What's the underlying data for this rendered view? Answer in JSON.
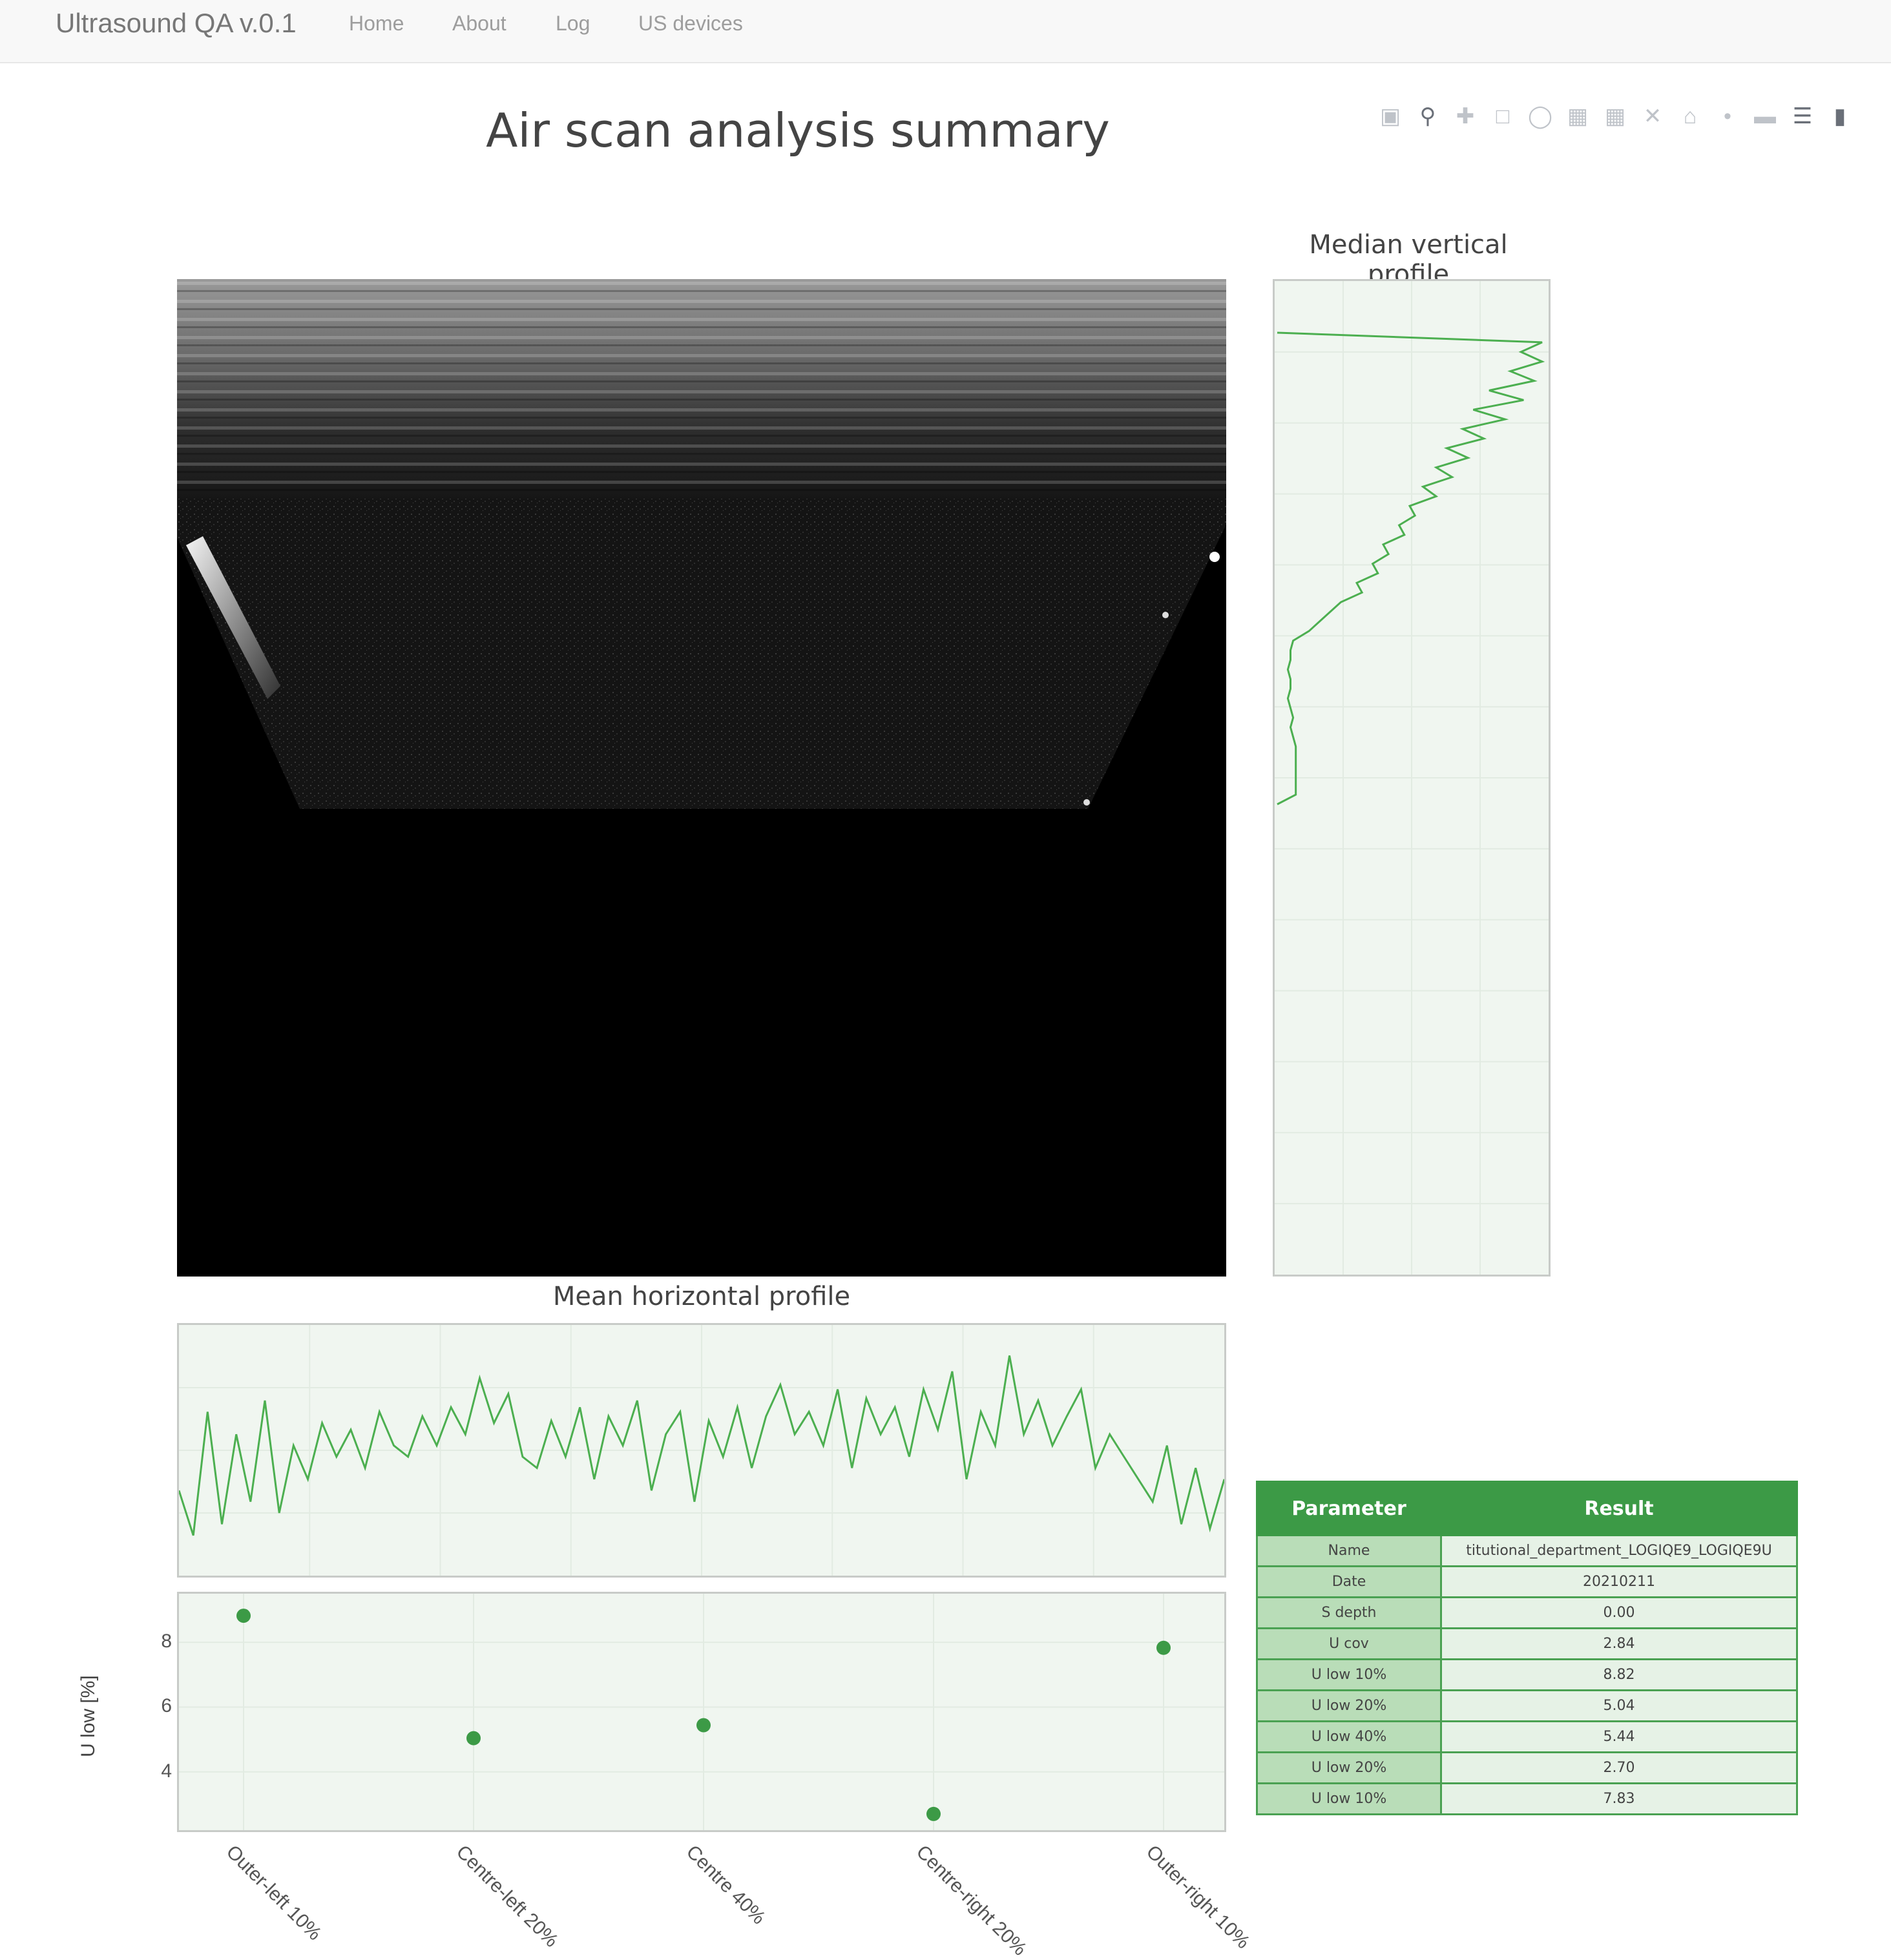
{
  "navbar": {
    "brand": "Ultrasound QA v.0.1",
    "links": [
      "Home",
      "About",
      "Log",
      "US devices"
    ]
  },
  "page_title": "Air scan analysis summary",
  "modebar_icons": [
    "camera-icon",
    "zoom-icon",
    "pan-icon",
    "box-select-icon",
    "lasso-select-icon",
    "zoom-in-icon",
    "zoom-out-icon",
    "autoscale-icon",
    "reset-axes-icon",
    "spike-lines-icon",
    "hover-closest-icon",
    "hover-compare-icon",
    "plotly-logo-icon"
  ],
  "colors": {
    "accent": "#3c9a46",
    "line": "#4caf50",
    "panel_bg": "#f0f6f0",
    "navbar_bg": "#f8f8f8"
  },
  "vertical_profile": {
    "title": "Median vertical profile"
  },
  "horizontal_profile": {
    "title": "Mean horizontal profile"
  },
  "chart_data": [
    {
      "type": "line",
      "title": "Median vertical profile",
      "orientation": "vertical",
      "note": "intensity vs depth; high noisy values near the top, dropping to a low flat baseline over mid depth, zero below",
      "series": [
        {
          "name": "",
          "values": [
            0.0,
            1.0,
            0.92,
            1.0,
            0.88,
            0.97,
            0.8,
            0.93,
            0.74,
            0.86,
            0.7,
            0.78,
            0.64,
            0.72,
            0.6,
            0.66,
            0.55,
            0.6,
            0.5,
            0.52,
            0.46,
            0.48,
            0.4,
            0.42,
            0.36,
            0.38,
            0.3,
            0.32,
            0.24,
            0.2,
            0.16,
            0.12,
            0.06,
            0.05,
            0.05,
            0.04,
            0.05,
            0.05,
            0.04,
            0.05,
            0.06,
            0.05,
            0.06,
            0.07,
            0.07,
            0.07,
            0.07,
            0.07,
            0.07,
            0.0
          ]
        }
      ]
    },
    {
      "type": "line",
      "title": "Mean horizontal profile",
      "series": [
        {
          "name": "",
          "values": [
            0.35,
            0.15,
            0.7,
            0.2,
            0.6,
            0.3,
            0.75,
            0.25,
            0.55,
            0.4,
            0.65,
            0.5,
            0.62,
            0.45,
            0.7,
            0.55,
            0.5,
            0.68,
            0.55,
            0.72,
            0.6,
            0.85,
            0.65,
            0.78,
            0.5,
            0.45,
            0.66,
            0.5,
            0.72,
            0.4,
            0.68,
            0.55,
            0.75,
            0.35,
            0.6,
            0.7,
            0.3,
            0.66,
            0.5,
            0.72,
            0.45,
            0.68,
            0.82,
            0.6,
            0.7,
            0.55,
            0.8,
            0.45,
            0.76,
            0.6,
            0.72,
            0.5,
            0.8,
            0.62,
            0.88,
            0.4,
            0.7,
            0.55,
            0.95,
            0.6,
            0.75,
            0.55,
            0.68,
            0.8,
            0.45,
            0.6,
            0.5,
            0.4,
            0.3,
            0.55,
            0.2,
            0.45,
            0.18,
            0.4
          ]
        }
      ]
    },
    {
      "type": "scatter",
      "categories": [
        "Outer-left 10%",
        "Centre-left 20%",
        "Centre 40%",
        "Centre-right 20%",
        "Outer-right 10%"
      ],
      "values": [
        8.82,
        5.04,
        5.44,
        2.7,
        7.83
      ],
      "ylabel": "U low [%]",
      "yticks": [
        4,
        6,
        8
      ],
      "ylim": [
        2.2,
        9.5
      ],
      "grid": true
    }
  ],
  "results_table": {
    "headers": [
      "Parameter",
      "Result"
    ],
    "rows": [
      {
        "parameter": "Name",
        "result": "titutional_department_LOGIQE9_LOGIQE9U"
      },
      {
        "parameter": "Date",
        "result": "20210211"
      },
      {
        "parameter": "S depth",
        "result": "0.00"
      },
      {
        "parameter": "U cov",
        "result": "2.84"
      },
      {
        "parameter": "U low 10%",
        "result": "8.82"
      },
      {
        "parameter": "U low 20%",
        "result": "5.04"
      },
      {
        "parameter": "U low 40%",
        "result": "5.44"
      },
      {
        "parameter": "U low 20%",
        "result": "2.70"
      },
      {
        "parameter": "U low 10%",
        "result": "7.83"
      }
    ]
  }
}
